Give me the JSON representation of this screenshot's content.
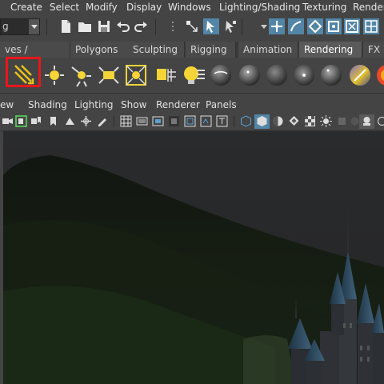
{
  "menubar": {
    "items": [
      "Create",
      "Select",
      "Modify",
      "Display",
      "Windows",
      "Lighting/Shading",
      "Texturing",
      "Render"
    ]
  },
  "toolbar": {
    "mode_dropdown_value": "g"
  },
  "shelf": {
    "tabs": [
      "ves / Surfaces",
      "Polygons",
      "Sculpting",
      "Rigging",
      "Animation",
      "Rendering",
      "FX"
    ],
    "active_tab": "Rendering",
    "icons": [
      "ambient-light-icon",
      "directional-light-icon",
      "point-light-icon",
      "spot-light-icon",
      "area-light-icon",
      "volume-light-icon",
      "light-editor-icon",
      "blinn-sphere-icon",
      "phong-sphere-icon",
      "lambert-sphere-icon",
      "anisotropic-sphere-icon",
      "phong-e-sphere-icon",
      "ramp-sphere-icon",
      "layered-sphere-icon"
    ],
    "highlighted_icon": "ambient-light-icon"
  },
  "panel": {
    "menu": [
      "ew",
      "Shading",
      "Lighting",
      "Show",
      "Renderer",
      "Panels"
    ]
  },
  "colors": {
    "highlight_box": "#e8161a",
    "active_button": "#5285a6",
    "ui_background": "#444444"
  }
}
